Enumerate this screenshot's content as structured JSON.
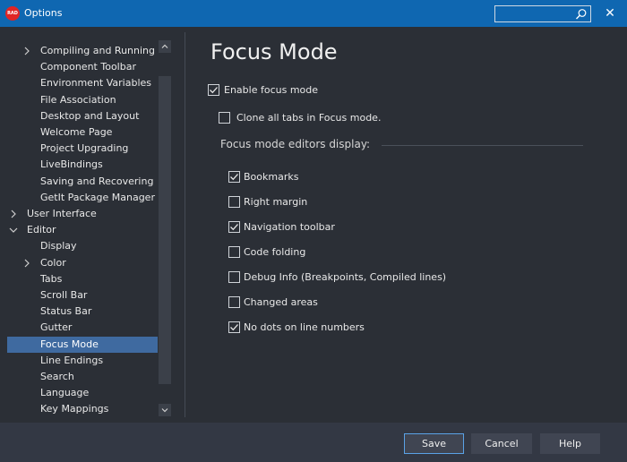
{
  "window": {
    "title": "Options",
    "app_icon_text": "RAD",
    "search_placeholder": "",
    "close_glyph": "✕",
    "titlebar_color": "#0f67b1"
  },
  "tree": {
    "items": [
      {
        "label": "Compiling and Running",
        "indent": 2,
        "chevron": "right"
      },
      {
        "label": "Component Toolbar",
        "indent": 2,
        "chevron": ""
      },
      {
        "label": "Environment Variables",
        "indent": 2,
        "chevron": ""
      },
      {
        "label": "File Association",
        "indent": 2,
        "chevron": ""
      },
      {
        "label": "Desktop and Layout",
        "indent": 2,
        "chevron": ""
      },
      {
        "label": "Welcome Page",
        "indent": 2,
        "chevron": ""
      },
      {
        "label": "Project Upgrading",
        "indent": 2,
        "chevron": ""
      },
      {
        "label": "LiveBindings",
        "indent": 2,
        "chevron": ""
      },
      {
        "label": "Saving and Recovering",
        "indent": 2,
        "chevron": ""
      },
      {
        "label": "GetIt Package Manager",
        "indent": 2,
        "chevron": ""
      },
      {
        "label": "User Interface",
        "indent": 1,
        "chevron": "right"
      },
      {
        "label": "Editor",
        "indent": 1,
        "chevron": "down"
      },
      {
        "label": "Display",
        "indent": 2,
        "chevron": ""
      },
      {
        "label": "Color",
        "indent": 2,
        "chevron": "right"
      },
      {
        "label": "Tabs",
        "indent": 2,
        "chevron": ""
      },
      {
        "label": "Scroll Bar",
        "indent": 2,
        "chevron": ""
      },
      {
        "label": "Status Bar",
        "indent": 2,
        "chevron": ""
      },
      {
        "label": "Gutter",
        "indent": 2,
        "chevron": ""
      },
      {
        "label": "Focus Mode",
        "indent": 2,
        "chevron": "",
        "selected": true
      },
      {
        "label": "Line Endings",
        "indent": 2,
        "chevron": ""
      },
      {
        "label": "Search",
        "indent": 2,
        "chevron": ""
      },
      {
        "label": "Language",
        "indent": 2,
        "chevron": ""
      },
      {
        "label": "Key Mappings",
        "indent": 2,
        "chevron": ""
      }
    ],
    "selected_color": "#3f6aa0"
  },
  "main": {
    "title": "Focus Mode",
    "enable_focus_mode": {
      "label": "Enable focus mode",
      "checked": true
    },
    "clone_all_tabs": {
      "label": "Clone all tabs in Focus mode.",
      "checked": false
    },
    "group_label": "Focus mode editors display:",
    "options": [
      {
        "label": "Bookmarks",
        "checked": true
      },
      {
        "label": "Right margin",
        "checked": false
      },
      {
        "label": "Navigation toolbar",
        "checked": true
      },
      {
        "label": "Code folding",
        "checked": false
      },
      {
        "label": "Debug Info (Breakpoints, Compiled lines)",
        "checked": false
      },
      {
        "label": "Changed areas",
        "checked": false
      },
      {
        "label": "No dots on line numbers",
        "checked": true
      }
    ]
  },
  "footer": {
    "save_label": "Save",
    "cancel_label": "Cancel",
    "help_label": "Help"
  }
}
